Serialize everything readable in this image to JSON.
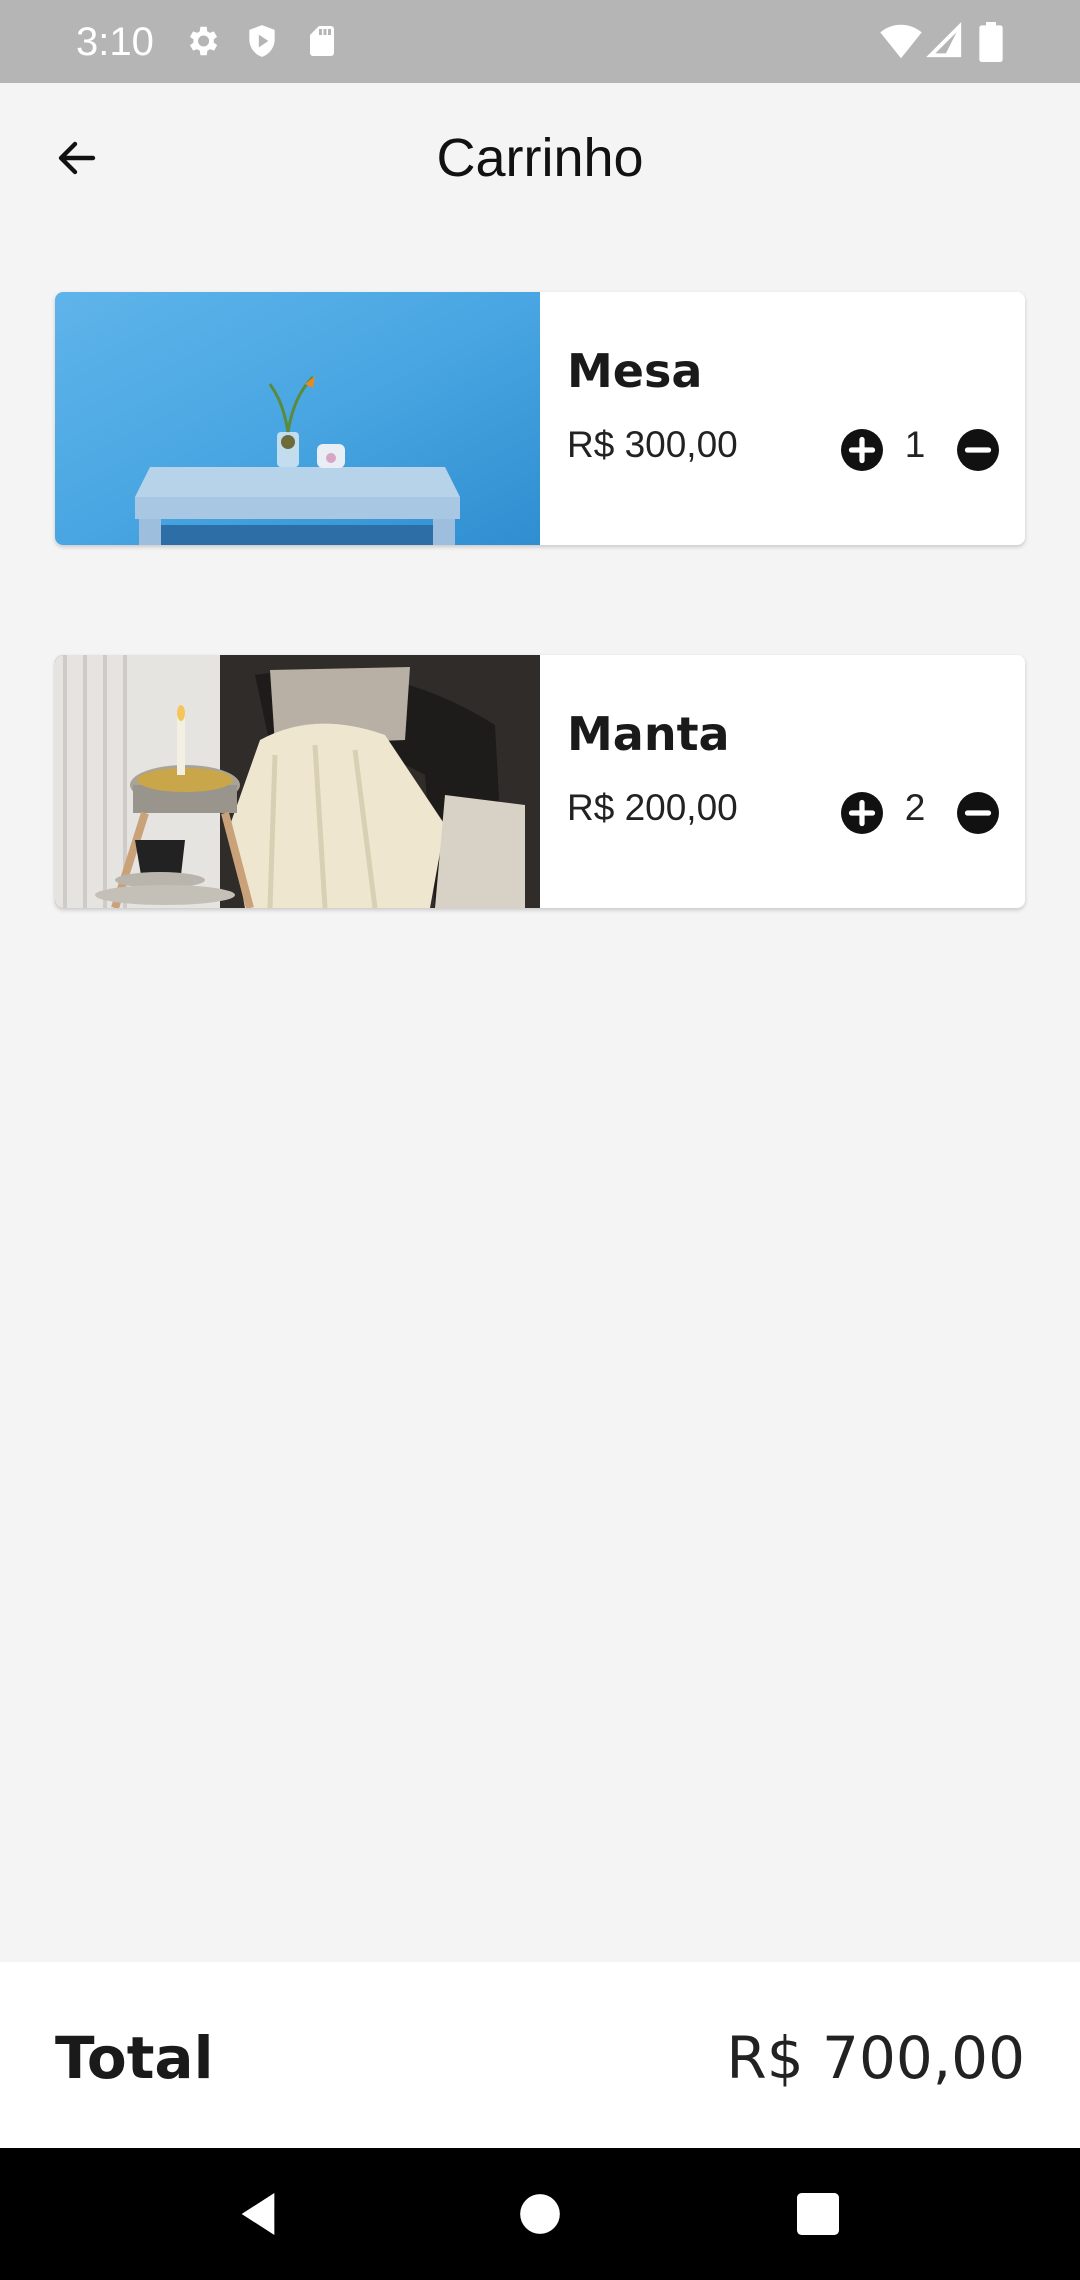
{
  "status_bar": {
    "time": "3:10",
    "icons": [
      "gear-icon",
      "shield-icon",
      "sd-card-icon",
      "wifi-icon",
      "signal-icon",
      "battery-icon"
    ]
  },
  "header": {
    "title": "Carrinho",
    "back_icon": "arrow-left-icon"
  },
  "cart": {
    "items": [
      {
        "name": "Mesa",
        "price": "R$ 300,00",
        "quantity": "1",
        "image": "blue-table-photo"
      },
      {
        "name": "Manta",
        "price": "R$ 200,00",
        "quantity": "2",
        "image": "blanket-chair-photo"
      }
    ]
  },
  "footer": {
    "total_label": "Total",
    "total_value": "R$ 700,00"
  },
  "nav": {
    "back": "nav-back-icon",
    "home": "nav-home-icon",
    "recents": "nav-recents-icon"
  },
  "colors": {
    "background": "#f4f4f4",
    "status_bar": "#b5b5b5",
    "card": "#ffffff",
    "text": "#1a1a1a",
    "nav_bar": "#000000"
  }
}
